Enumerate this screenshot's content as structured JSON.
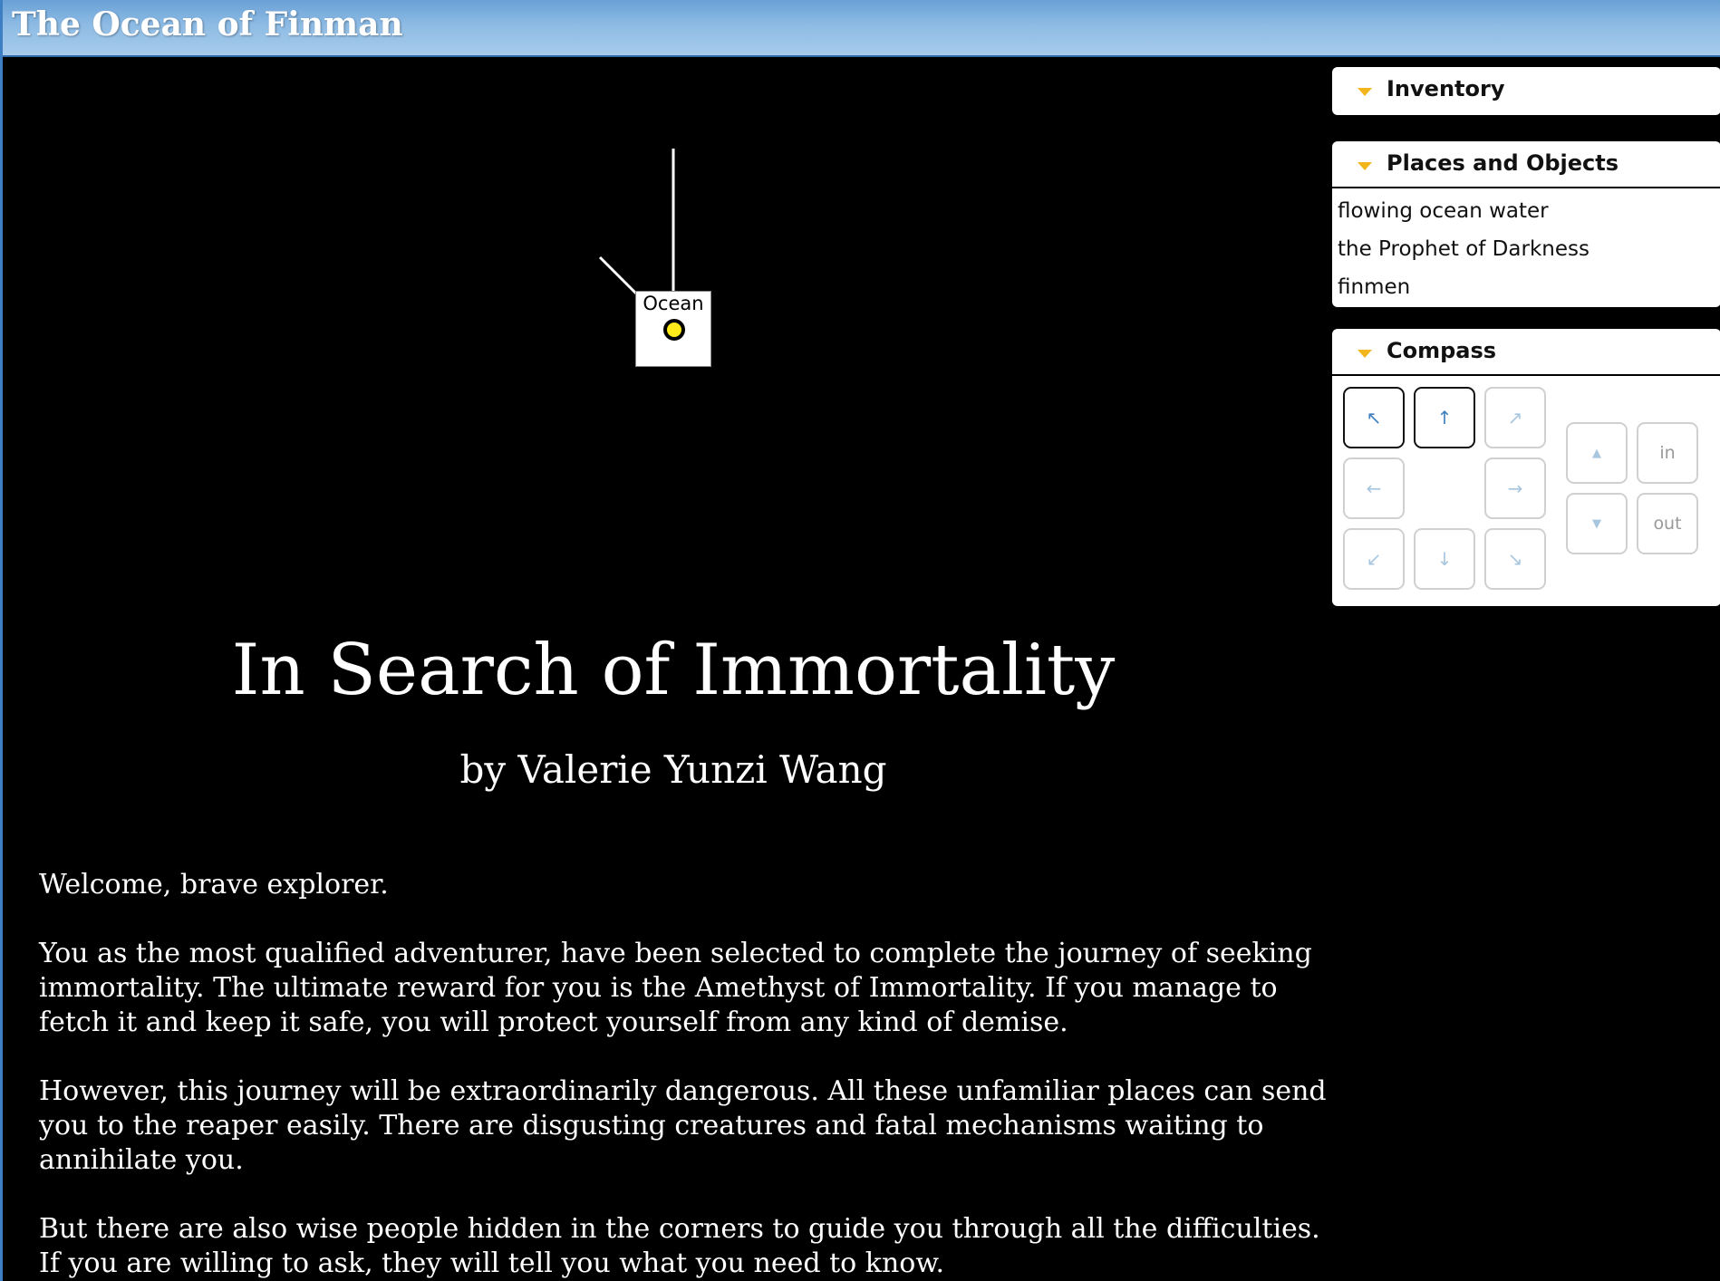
{
  "window": {
    "title": "The Ocean of Finman"
  },
  "map": {
    "room_label": "Ocean"
  },
  "story": {
    "title": "In Search of Immortality",
    "byline": "by Valerie Yunzi Wang",
    "paragraphs": [
      "Welcome, brave explorer.",
      "You as the most qualified adventurer, have been selected to complete the journey of seeking immortality. The ultimate reward for you is the Amethyst of Immortality. If you manage to fetch it and keep it safe, you will protect yourself from any kind of demise.",
      "However, this journey will be extraordinarily dangerous. All these unfamiliar places can send you to the reaper easily. There are disgusting creatures and fatal mechanisms waiting to annihilate you.",
      "But there are also wise people hidden in the corners to guide you through all the difficulties. If you are willing to ask, they will tell you what you need to know."
    ]
  },
  "panels": {
    "inventory": {
      "title": "Inventory",
      "items": []
    },
    "places": {
      "title": "Places and Objects",
      "items": [
        "flowing ocean water",
        "the Prophet of Darkness",
        "finmen"
      ]
    },
    "compass": {
      "title": "Compass",
      "buttons": {
        "nw": {
          "glyph": "↖",
          "enabled": true
        },
        "n": {
          "glyph": "↑",
          "enabled": true
        },
        "ne": {
          "glyph": "↗",
          "enabled": false
        },
        "w": {
          "glyph": "←",
          "enabled": false
        },
        "e": {
          "glyph": "→",
          "enabled": false
        },
        "sw": {
          "glyph": "↙",
          "enabled": false
        },
        "s": {
          "glyph": "↓",
          "enabled": false
        },
        "se": {
          "glyph": "↘",
          "enabled": false
        },
        "up": {
          "glyph": "▲",
          "enabled": false
        },
        "down": {
          "glyph": "▼",
          "enabled": false
        },
        "in": {
          "label": "in",
          "enabled": false
        },
        "out": {
          "label": "out",
          "enabled": false
        }
      }
    }
  },
  "colors": {
    "title_bar": "#8dbbe4",
    "background": "#000000",
    "panel_triangle": "#f2b51c",
    "room_marker": "#ffeb1a",
    "compass_enabled_arrow": "#3f7fbf",
    "compass_disabled_arrow": "#a9c6df"
  }
}
